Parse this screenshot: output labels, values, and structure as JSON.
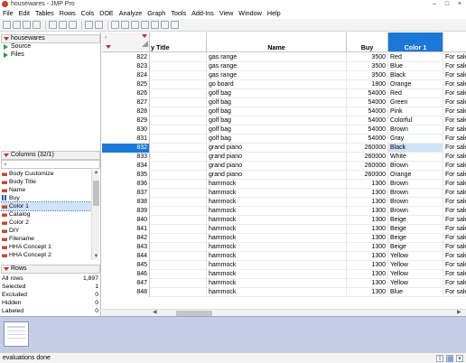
{
  "window": {
    "title": "housewares - JMP Pro",
    "minimize": "–",
    "maximize": "□",
    "close": "×"
  },
  "menu": [
    "File",
    "Edit",
    "Tables",
    "Rows",
    "Cols",
    "DOE",
    "Analyze",
    "Graph",
    "Tools",
    "Add-Ins",
    "View",
    "Window",
    "Help"
  ],
  "table_panel": {
    "title": "housewares",
    "items": [
      "Source",
      "Files"
    ]
  },
  "columns_panel": {
    "title": "Columns (32/1)",
    "items": [
      {
        "label": "Body Customize",
        "type": "nominal"
      },
      {
        "label": "Body Title",
        "type": "nominal"
      },
      {
        "label": "Name",
        "type": "nominal"
      },
      {
        "label": "Buy",
        "type": "continuous"
      },
      {
        "label": "Color 1",
        "type": "nominal",
        "selected": true
      },
      {
        "label": "Catalog",
        "type": "nominal"
      },
      {
        "label": "Color 2",
        "type": "nominal"
      },
      {
        "label": "DIY",
        "type": "nominal"
      },
      {
        "label": "Filename",
        "type": "nominal"
      },
      {
        "label": "HHA Concept 1",
        "type": "nominal"
      },
      {
        "label": "HHA Concept 2",
        "type": "nominal"
      }
    ]
  },
  "rows_panel": {
    "title": "Rows",
    "stats": [
      {
        "label": "All rows",
        "value": "1,897"
      },
      {
        "label": "Selected",
        "value": "1"
      },
      {
        "label": "Excluded",
        "value": "0"
      },
      {
        "label": "Hidden",
        "value": "0"
      },
      {
        "label": "Labeled",
        "value": "0"
      }
    ]
  },
  "grid": {
    "headers": [
      "y Title",
      "Name",
      "Buy",
      "Color 1",
      ""
    ],
    "rows": [
      {
        "n": "822",
        "name": "gas range",
        "buy": "3500",
        "color": "Red",
        "extra": "For sale"
      },
      {
        "n": "823",
        "name": "gas range",
        "buy": "3500",
        "color": "Blue",
        "extra": "For sale"
      },
      {
        "n": "824",
        "name": "gas range",
        "buy": "3500",
        "color": "Black",
        "extra": "For sale"
      },
      {
        "n": "825",
        "name": "go board",
        "buy": "1800",
        "color": "Orange",
        "extra": "For sale"
      },
      {
        "n": "826",
        "name": "golf bag",
        "buy": "54000",
        "color": "Red",
        "extra": "For sale"
      },
      {
        "n": "827",
        "name": "golf bag",
        "buy": "54000",
        "color": "Green",
        "extra": "For sale"
      },
      {
        "n": "828",
        "name": "golf bag",
        "buy": "54000",
        "color": "Pink",
        "extra": "For sale"
      },
      {
        "n": "829",
        "name": "golf bag",
        "buy": "54000",
        "color": "Colorful",
        "extra": "For sale"
      },
      {
        "n": "830",
        "name": "golf bag",
        "buy": "54000",
        "color": "Brown",
        "extra": "For sale"
      },
      {
        "n": "831",
        "name": "golf bag",
        "buy": "54000",
        "color": "Gray",
        "extra": "For sale"
      },
      {
        "n": "832",
        "name": "grand piano",
        "buy": "260000",
        "color": "Black",
        "extra": "For sale",
        "selected": true
      },
      {
        "n": "833",
        "name": "grand piano",
        "buy": "260000",
        "color": "White",
        "extra": "For sale"
      },
      {
        "n": "834",
        "name": "grand piano",
        "buy": "260000",
        "color": "Brown",
        "extra": "For sale"
      },
      {
        "n": "835",
        "name": "grand piano",
        "buy": "260000",
        "color": "Orange",
        "extra": "For sale"
      },
      {
        "n": "836",
        "name": "hammock",
        "buy": "1300",
        "color": "Brown",
        "extra": "For sale"
      },
      {
        "n": "837",
        "name": "hammock",
        "buy": "1300",
        "color": "Brown",
        "extra": "For sale"
      },
      {
        "n": "838",
        "name": "hammock",
        "buy": "1300",
        "color": "Brown",
        "extra": "For sale"
      },
      {
        "n": "839",
        "name": "hammock",
        "buy": "1300",
        "color": "Brown",
        "extra": "For sale"
      },
      {
        "n": "840",
        "name": "hammock",
        "buy": "1300",
        "color": "Beige",
        "extra": "For sale"
      },
      {
        "n": "841",
        "name": "hammock",
        "buy": "1300",
        "color": "Beige",
        "extra": "For sale"
      },
      {
        "n": "842",
        "name": "hammock",
        "buy": "1300",
        "color": "Beige",
        "extra": "For sale"
      },
      {
        "n": "843",
        "name": "hammock",
        "buy": "1300",
        "color": "Beige",
        "extra": "For sale"
      },
      {
        "n": "844",
        "name": "hammock",
        "buy": "1300",
        "color": "Yellow",
        "extra": "For sale"
      },
      {
        "n": "845",
        "name": "hammock",
        "buy": "1300",
        "color": "Yellow",
        "extra": "For sale"
      },
      {
        "n": "846",
        "name": "hammock",
        "buy": "1300",
        "color": "Yellow",
        "extra": "For sale"
      },
      {
        "n": "847",
        "name": "hammock",
        "buy": "1300",
        "color": "Yellow",
        "extra": "For sale"
      },
      {
        "n": "848",
        "name": "hammock",
        "buy": "1300",
        "color": "Blue",
        "extra": "For sale"
      }
    ]
  },
  "status": {
    "text": "evaluations done"
  },
  "colors": {
    "accent": "#1b78d6",
    "selection": "#cfe3fb",
    "disclosure": "#c0312a",
    "thumb_strip": "#c5cde6"
  }
}
